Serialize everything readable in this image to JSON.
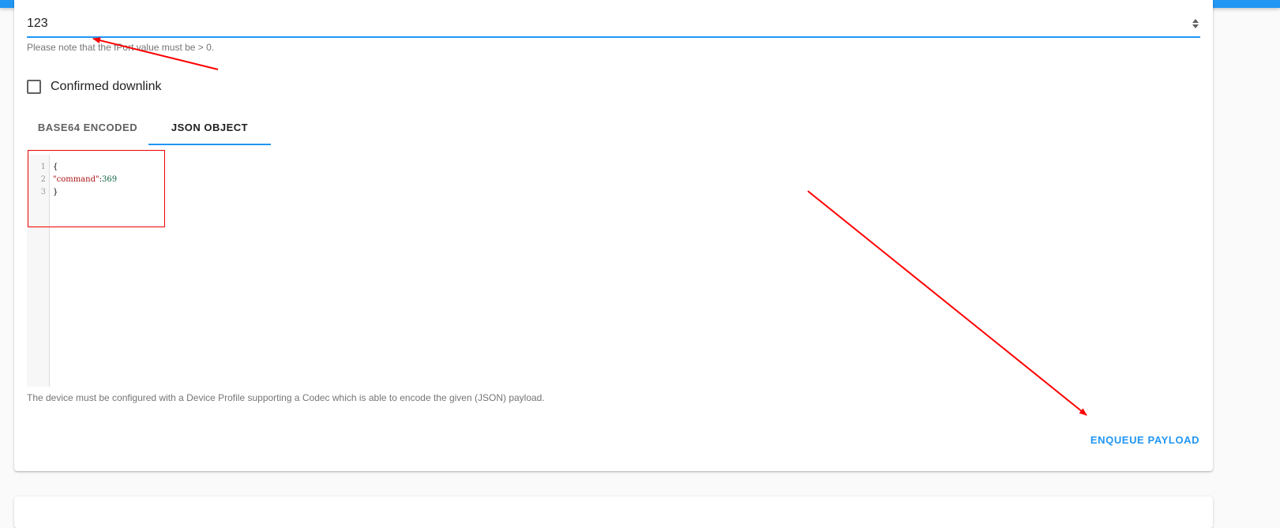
{
  "fport": {
    "value": "123",
    "helper": "Please note that the fPort value must be > 0."
  },
  "confirmed": {
    "label": "Confirmed downlink",
    "checked": false
  },
  "tabs": [
    {
      "label": "BASE64 ENCODED",
      "active": false
    },
    {
      "label": "JSON OBJECT",
      "active": true
    }
  ],
  "editor": {
    "line_numbers": [
      "1",
      "2",
      "3"
    ],
    "lines": {
      "l1": "{",
      "l2_key": "\"command\"",
      "l2_sep": ":",
      "l2_val": "369",
      "l3": "}"
    }
  },
  "codec_helper": "The device must be configured with a Device Profile supporting a Codec which is able to encode the given (JSON) payload.",
  "enqueue_label": "ENQUEUE PAYLOAD",
  "colors": {
    "accent": "#2196f3",
    "annotation": "#ff0000"
  }
}
